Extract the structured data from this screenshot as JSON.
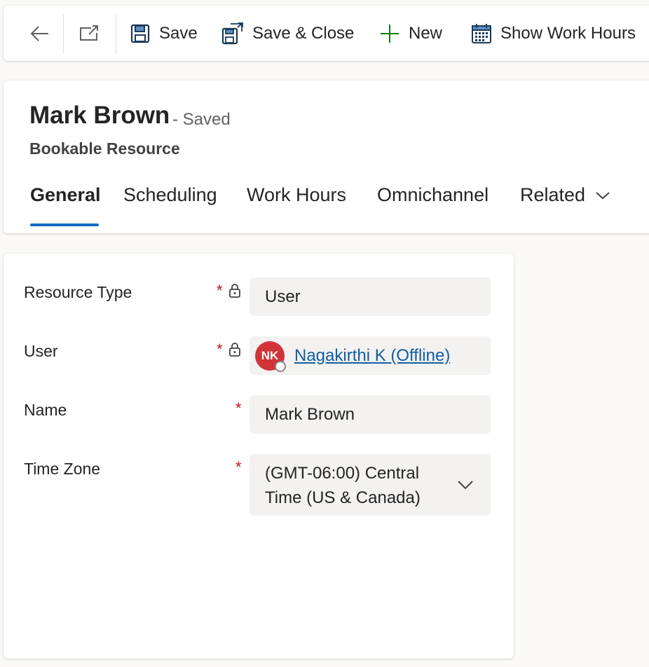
{
  "toolbar": {
    "back_icon": "arrow-left-icon",
    "popout_icon": "open-in-new-window-icon",
    "save_label": "Save",
    "save_close_label": "Save & Close",
    "new_label": "New",
    "show_work_hours_label": "Show Work Hours"
  },
  "header": {
    "title": "Mark Brown",
    "status": "- Saved",
    "entity": "Bookable Resource",
    "tabs": [
      {
        "label": "General",
        "active": true
      },
      {
        "label": "Scheduling"
      },
      {
        "label": "Work Hours"
      },
      {
        "label": "Omnichannel"
      },
      {
        "label": "Related"
      }
    ]
  },
  "form": {
    "resource_type": {
      "label": "Resource Type",
      "required": "*",
      "value": "User"
    },
    "user": {
      "label": "User",
      "required": "*",
      "avatar_initials": "NK",
      "value": "Nagakirthi K (Offline)"
    },
    "name": {
      "label": "Name",
      "required": "*",
      "value": "Mark Brown"
    },
    "time_zone": {
      "label": "Time Zone",
      "required": "*",
      "value_line1": "(GMT-06:00) Central",
      "value_line2": "Time (US & Canada)"
    }
  },
  "colors": {
    "accent": "#0f6cbd",
    "required": "#c50f1f",
    "avatar": "#d13438",
    "link": "#115ea3"
  }
}
